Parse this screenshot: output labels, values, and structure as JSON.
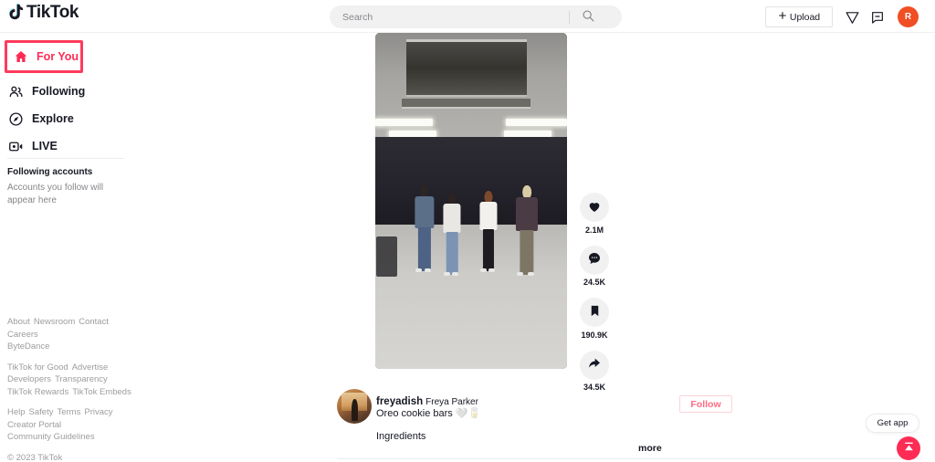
{
  "app": {
    "name": "TikTok",
    "logo_text": "TikTok"
  },
  "header": {
    "search": {
      "placeholder": "Search",
      "value": "",
      "icon": "search-icon"
    },
    "upload_label": "Upload",
    "upload_icon": "plus-icon",
    "send_icon": "paper-plane-icon",
    "message_icon": "message-icon",
    "avatar_initial": "R",
    "avatar_color": "#F04E23"
  },
  "sidebar": {
    "nav": [
      {
        "label": "For You",
        "icon": "home-icon",
        "active": true
      },
      {
        "label": "Following",
        "icon": "people-icon",
        "active": false
      },
      {
        "label": "Explore",
        "icon": "compass-icon",
        "active": false
      },
      {
        "label": "LIVE",
        "icon": "live-video-icon",
        "active": false
      }
    ],
    "following_accounts": {
      "title": "Following accounts",
      "empty_text": "Accounts you follow will appear here"
    },
    "footer_groups": [
      {
        "links": [
          "About",
          "Newsroom",
          "Contact",
          "Careers"
        ]
      },
      {
        "links": [
          "ByteDance"
        ]
      },
      {
        "links": [
          "TikTok for Good",
          "Advertise"
        ]
      },
      {
        "links": [
          "Developers",
          "Transparency"
        ]
      },
      {
        "links": [
          "TikTok Rewards",
          "TikTok Embeds"
        ]
      },
      {
        "links": [
          "Help",
          "Safety",
          "Terms",
          "Privacy"
        ]
      },
      {
        "links": [
          "Creator Portal"
        ]
      },
      {
        "links": [
          "Community Guidelines"
        ]
      }
    ],
    "copyright": "© 2023 TikTok"
  },
  "feed": {
    "video": {
      "alt": "Four dancers standing in a dance practice room with dark curtains"
    },
    "engagement": [
      {
        "name": "like",
        "icon": "heart-icon",
        "count": "2.1M"
      },
      {
        "name": "comment",
        "icon": "comment-icon",
        "count": "24.5K"
      },
      {
        "name": "bookmark",
        "icon": "bookmark-icon",
        "count": "190.9K"
      },
      {
        "name": "share",
        "icon": "share-icon",
        "count": "34.5K"
      }
    ],
    "creator": {
      "username": "freyadish",
      "display_name": "Freya Parker",
      "caption": "Oreo cookie bars 🤍🥛",
      "caption_second_line": "Ingredients",
      "follow_label": "Follow",
      "more_label": "more"
    }
  },
  "floating": {
    "get_app_label": "Get app",
    "scroll_top_icon": "scroll-to-top-icon"
  },
  "colors": {
    "brand_red": "#FE2C55",
    "brand_cyan": "#25F4EE",
    "highlight_box": "#FE3B5C",
    "text_primary": "#161823",
    "text_muted": "#86878b"
  }
}
